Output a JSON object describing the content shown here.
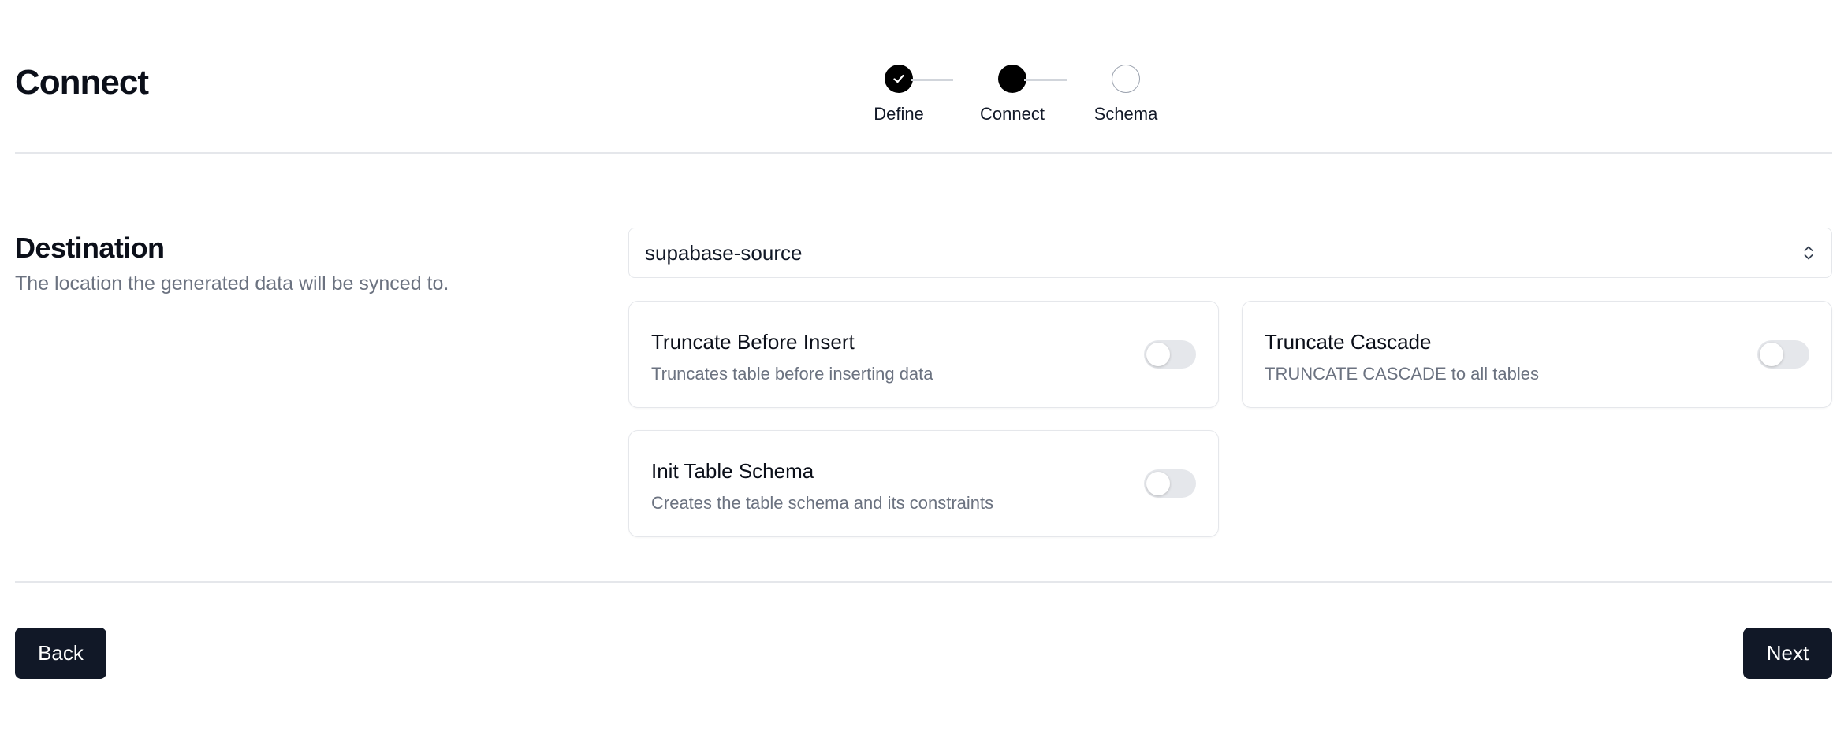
{
  "header": {
    "title": "Connect"
  },
  "stepper": {
    "steps": [
      {
        "label": "Define",
        "state": "done"
      },
      {
        "label": "Connect",
        "state": "current"
      },
      {
        "label": "Schema",
        "state": "upcoming"
      }
    ]
  },
  "destination": {
    "title": "Destination",
    "description": "The location the generated data will be synced to.",
    "select": {
      "value": "supabase-source",
      "icon": "chevron-up-down-icon"
    }
  },
  "options": [
    {
      "title": "Truncate Before Insert",
      "description": "Truncates table before inserting data",
      "enabled": false
    },
    {
      "title": "Truncate Cascade",
      "description": "TRUNCATE CASCADE to all tables",
      "enabled": false
    },
    {
      "title": "Init Table Schema",
      "description": "Creates the table schema and its constraints",
      "enabled": false
    }
  ],
  "footer": {
    "back_label": "Back",
    "next_label": "Next"
  },
  "colors": {
    "primary_button": "#111827",
    "step_active": "#000000",
    "muted_text": "#6b7280",
    "border": "#e5e7eb"
  }
}
